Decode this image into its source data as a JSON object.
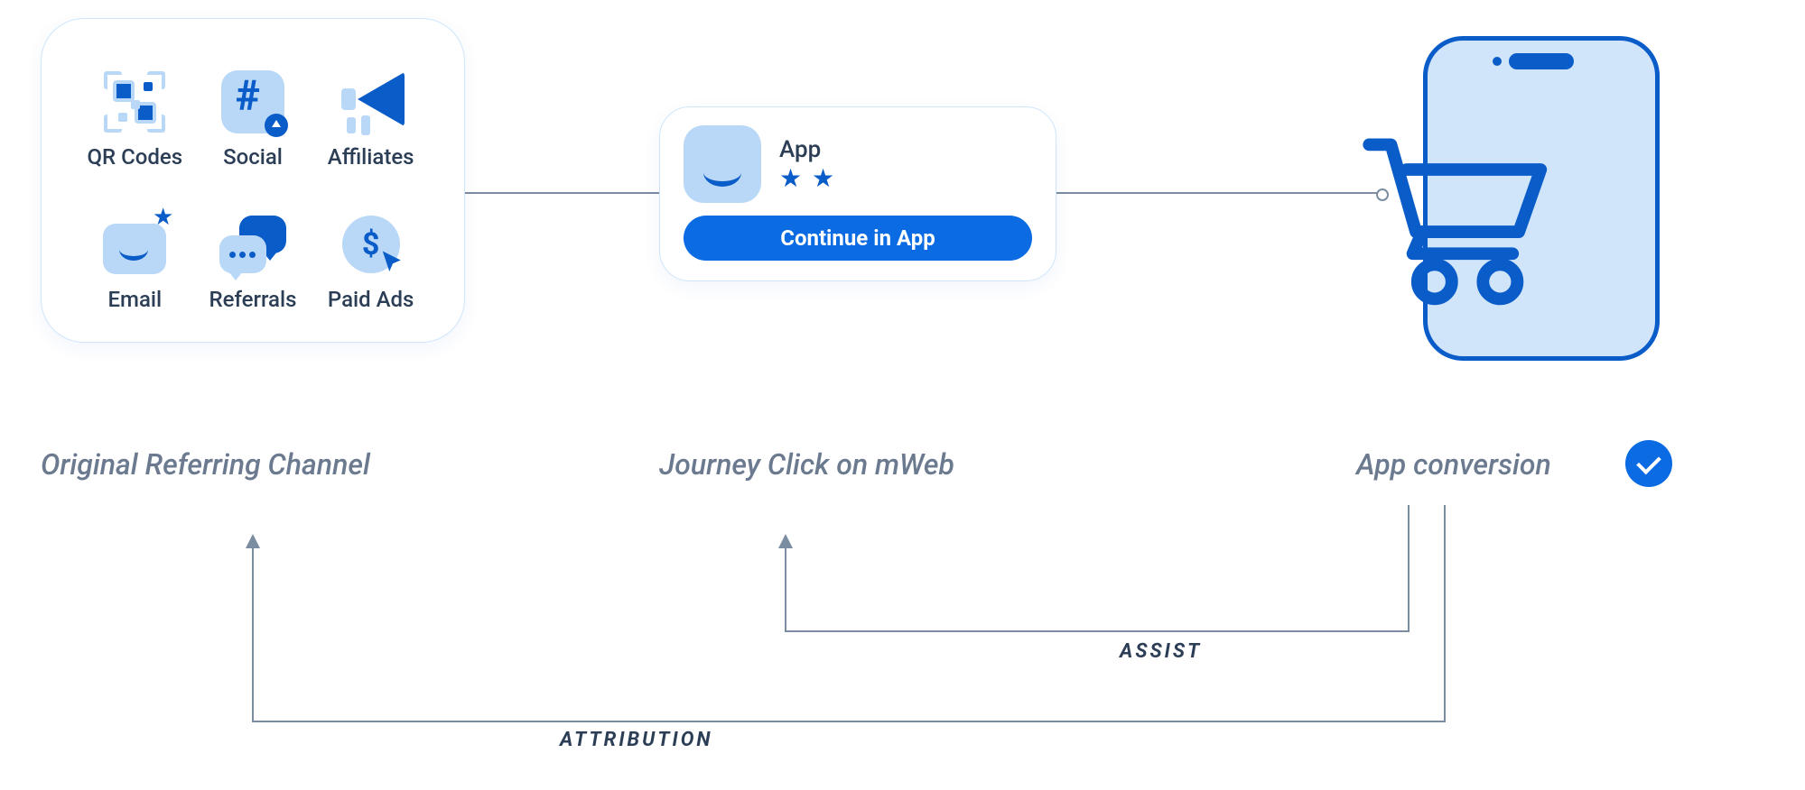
{
  "channels": {
    "items": [
      {
        "icon": "qr-icon",
        "label": "QR Codes"
      },
      {
        "icon": "social-icon",
        "label": "Social"
      },
      {
        "icon": "affiliates-icon",
        "label": "Affiliates"
      },
      {
        "icon": "email-icon",
        "label": "Email"
      },
      {
        "icon": "referrals-icon",
        "label": "Referrals"
      },
      {
        "icon": "paid-ads-icon",
        "label": "Paid Ads"
      }
    ]
  },
  "app_banner": {
    "name": "App",
    "stars": "★ ★",
    "cta_label": "Continue in App"
  },
  "stages": {
    "channel_label": "Original Referring Channel",
    "mweb_label": "Journey Click on mWeb",
    "conversion_label": "App conversion"
  },
  "flows": {
    "assist_label": "ASSIST",
    "attribution_label": "ATTRIBUTION"
  }
}
